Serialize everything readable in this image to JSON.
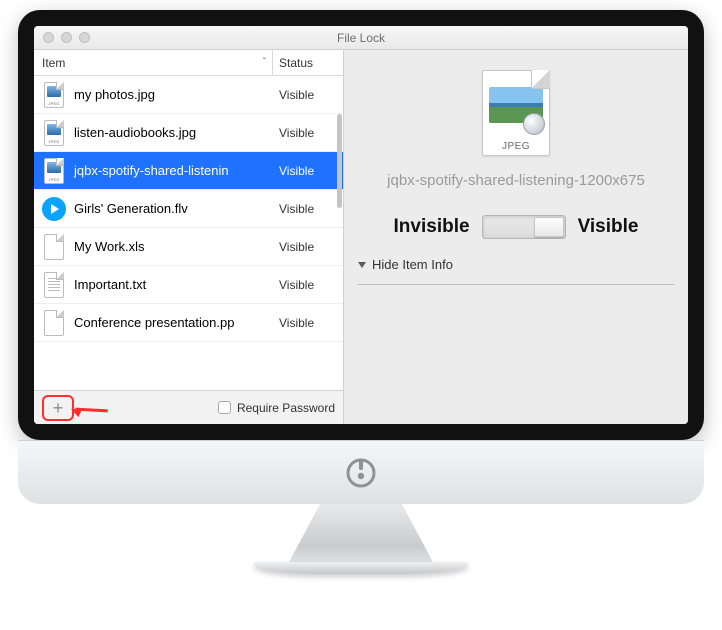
{
  "window": {
    "title": "File Lock"
  },
  "columns": {
    "item": "Item",
    "status": "Status"
  },
  "items": [
    {
      "name": "my photos.jpg",
      "status": "Visible",
      "icon": "jpeg",
      "selected": false
    },
    {
      "name": "listen-audiobooks.jpg",
      "status": "Visible",
      "icon": "jpeg",
      "selected": false
    },
    {
      "name": "jqbx-spotify-shared-listenin",
      "status": "Visible",
      "icon": "jpeg",
      "selected": true
    },
    {
      "name": "Girls' Generation.flv",
      "status": "Visible",
      "icon": "flv",
      "selected": false
    },
    {
      "name": "My Work.xls",
      "status": "Visible",
      "icon": "blank",
      "selected": false
    },
    {
      "name": "Important.txt",
      "status": "Visible",
      "icon": "txt",
      "selected": false
    },
    {
      "name": "Conference presentation.pp",
      "status": "Visible",
      "icon": "blank",
      "selected": false
    }
  ],
  "footer": {
    "require_password": "Require Password"
  },
  "detail": {
    "preview_caption": "JPEG",
    "filename": "jqbx-spotify-shared-listening-1200x675",
    "invisible": "Invisible",
    "visible": "Visible",
    "state": "visible",
    "disclosure": "Hide Item Info"
  }
}
